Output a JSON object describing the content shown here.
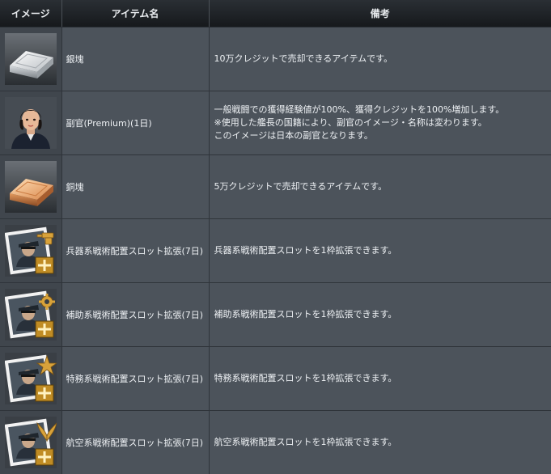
{
  "headers": {
    "image": "イメージ",
    "name": "アイテム名",
    "note": "備考"
  },
  "rows": [
    {
      "icon": "silver-ingot-icon",
      "name": "銀塊",
      "note": [
        "10万クレジットで売却できるアイテムです。"
      ]
    },
    {
      "icon": "adjutant-portrait-icon",
      "name": "副官(Premium)(1日)",
      "note": [
        "一般戦闘での獲得経験値が100%、獲得クレジットを100%増加します。",
        "※使用した艦長の国籍により、副官のイメージ・名称は変わります。",
        "このイメージは日本の副官となります。"
      ]
    },
    {
      "icon": "copper-ingot-icon",
      "name": "銅塊",
      "note": [
        "5万クレジットで売却できるアイテムです。"
      ]
    },
    {
      "icon": "weapon-slot-expand-icon",
      "name": "兵器系戦術配置スロット拡張(7日)",
      "note": [
        "兵器系戦術配置スロットを1枠拡張できます。"
      ]
    },
    {
      "icon": "support-slot-expand-icon",
      "name": "補助系戦術配置スロット拡張(7日)",
      "note": [
        "補助系戦術配置スロットを1枠拡張できます。"
      ]
    },
    {
      "icon": "special-slot-expand-icon",
      "name": "特務系戦術配置スロット拡張(7日)",
      "note": [
        "特務系戦術配置スロットを1枠拡張できます。"
      ]
    },
    {
      "icon": "air-slot-expand-icon",
      "name": "航空系戦術配置スロット拡張(7日)",
      "note": [
        "航空系戦術配置スロットを1枠拡張できます。"
      ]
    }
  ]
}
